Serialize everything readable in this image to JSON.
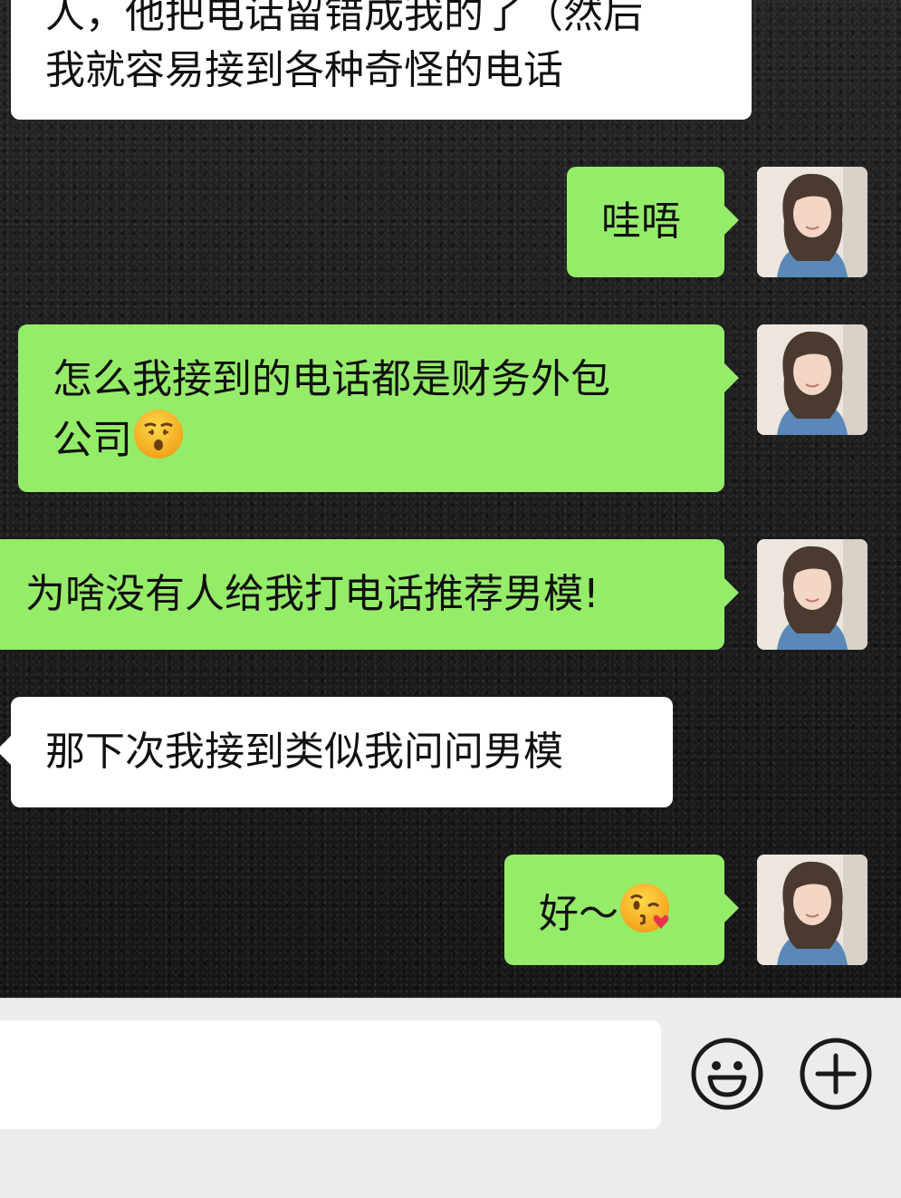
{
  "chat": {
    "messages": [
      {
        "side": "in",
        "lines": [
          "人，他把电话留错成我的了（然后",
          "我就容易接到各种奇怪的电话"
        ]
      },
      {
        "side": "out",
        "text": "哇唔"
      },
      {
        "side": "out",
        "line1": "怎么我接到的电话都是财务外包",
        "line2": "公司",
        "emoji": "kissing-face-closed-eyes"
      },
      {
        "side": "out",
        "text": "为啥没有人给我打电话推荐男模!"
      },
      {
        "side": "in",
        "text": "那下次我接到类似我问问男模"
      },
      {
        "side": "out",
        "text": "好～",
        "emoji": "face-blowing-kiss"
      }
    ]
  },
  "input_bar": {
    "text_value": "",
    "emoji_button_icon": "smiley-icon",
    "more_button_icon": "plus-circle-icon"
  },
  "colors": {
    "outgoing_bubble": "#95ec69",
    "incoming_bubble": "#ffffff",
    "input_bar_bg": "#ececec"
  }
}
